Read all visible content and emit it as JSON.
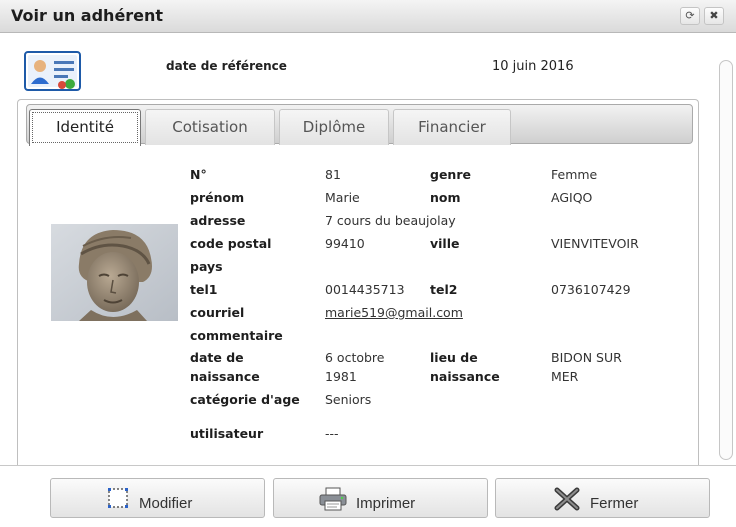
{
  "window": {
    "title": "Voir un adhérent",
    "refresh_glyph": "⟳",
    "close_glyph": "✖"
  },
  "header": {
    "icon": "member-card-icon",
    "ref_label": "date de référence",
    "ref_value": "10 juin 2016"
  },
  "tabs": [
    {
      "label": "Identité",
      "active": true
    },
    {
      "label": "Cotisation",
      "active": false
    },
    {
      "label": "Diplôme",
      "active": false
    },
    {
      "label": "Financier",
      "active": false
    }
  ],
  "fields": {
    "numero": {
      "label": "N°",
      "value": "81"
    },
    "genre": {
      "label": "genre",
      "value": "Femme"
    },
    "prenom": {
      "label": "prénom",
      "value": "Marie"
    },
    "nom": {
      "label": "nom",
      "value": "AGIQO"
    },
    "adresse": {
      "label": "adresse",
      "value": "7 cours du beaujolay"
    },
    "code_postal": {
      "label": "code postal",
      "value": "99410"
    },
    "ville": {
      "label": "ville",
      "value": "VIENVITEVOIR"
    },
    "pays": {
      "label": "pays",
      "value": ""
    },
    "tel1": {
      "label": "tel1",
      "value": "0014435713"
    },
    "tel2": {
      "label": "tel2",
      "value": "0736107429"
    },
    "courriel": {
      "label": "courriel",
      "value": "marie519@gmail.com"
    },
    "commentaire": {
      "label": "commentaire",
      "value": ""
    },
    "date_naissance": {
      "label_line1": "date de",
      "label_line2": "naissance",
      "value_line1": "6 octobre",
      "value_line2": "1981"
    },
    "lieu_naissance": {
      "label_line1": "lieu de",
      "label_line2": "naissance",
      "value_line1": "BIDON SUR",
      "value_line2": "MER"
    },
    "categorie_age": {
      "label": "catégorie d'age",
      "value": "Seniors"
    },
    "utilisateur": {
      "label": "utilisateur",
      "value": "---"
    }
  },
  "buttons": {
    "modifier": {
      "label": "Modifier",
      "icon": "edit-frame-icon"
    },
    "imprimer": {
      "label": "Imprimer",
      "icon": "printer-icon"
    },
    "fermer": {
      "label": "Fermer",
      "icon": "close-x-icon"
    }
  },
  "colors": {
    "titlebar": "#dadada",
    "link": "#333333"
  }
}
